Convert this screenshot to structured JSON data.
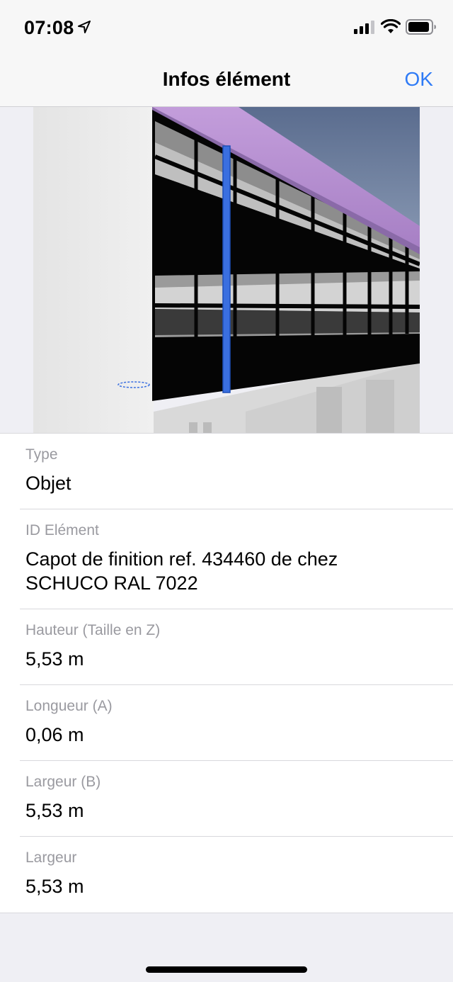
{
  "status_bar": {
    "time": "07:08",
    "icons": [
      "location-arrow-icon",
      "cellular-signal-icon",
      "wifi-icon",
      "battery-icon"
    ]
  },
  "nav": {
    "title": "Infos élément",
    "ok_label": "OK"
  },
  "colors": {
    "accent": "#2f7bf6",
    "label": "#9a9aa0",
    "selection": "#3a6fe0",
    "roof": "#b98fd4"
  },
  "properties": [
    {
      "label": "Type",
      "value": "Objet"
    },
    {
      "label": "ID Elément",
      "value": "Capot de finition ref. 434460 de chez SCHUCO RAL 7022"
    },
    {
      "label": "Hauteur (Taille en Z)",
      "value": "5,53 m"
    },
    {
      "label": "Longueur (A)",
      "value": "0,06 m"
    },
    {
      "label": "Largeur (B)",
      "value": "5,53 m"
    },
    {
      "label": "Largeur",
      "value": "5,53 m"
    }
  ]
}
